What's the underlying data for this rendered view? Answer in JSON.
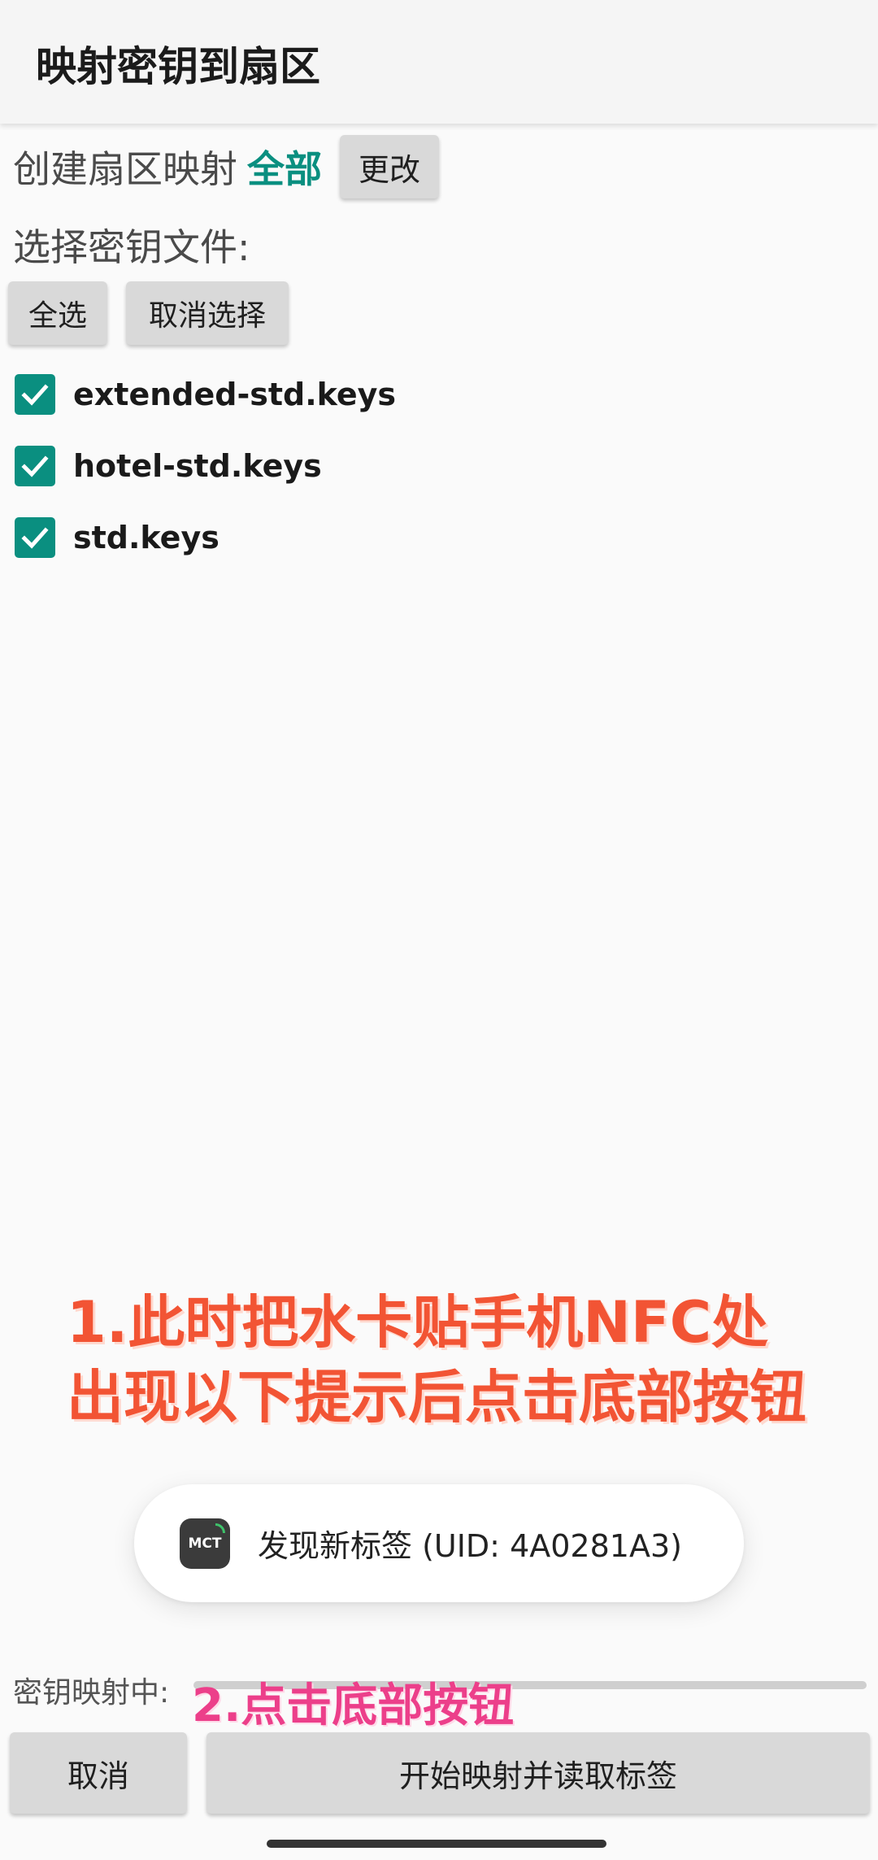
{
  "appbar": {
    "title": "映射密钥到扇区"
  },
  "sector_map": {
    "label": "创建扇区映射",
    "value": "全部",
    "change_label": "更改"
  },
  "key_files": {
    "label": "选择密钥文件:",
    "select_all_label": "全选",
    "deselect_label": "取消选择",
    "items": [
      {
        "name": "extended-std.keys",
        "checked": true
      },
      {
        "name": "hotel-std.keys",
        "checked": true
      },
      {
        "name": "std.keys",
        "checked": true
      }
    ]
  },
  "annotation_1": {
    "line1": "1.此时把水卡贴手机NFC处",
    "line2": "出现以下提示后点击底部按钮"
  },
  "toast": {
    "logo_text": "MCT",
    "message": "发现新标签 (UID: 4A0281A3)"
  },
  "progress": {
    "label": "密钥映射中:",
    "value": 0
  },
  "annotation_2": {
    "text": "2.点击底部按钮"
  },
  "bottom_bar": {
    "cancel_label": "取消",
    "start_label": "开始映射并读取标签"
  },
  "colors": {
    "accent": "#0a8f80",
    "annotation_red": "#f25434",
    "annotation_pink": "#ec3f8a"
  }
}
